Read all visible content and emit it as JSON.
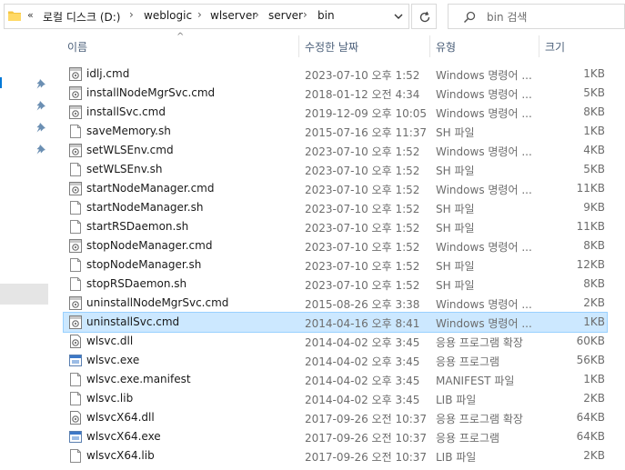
{
  "address": {
    "overflow": "«",
    "crumbs": [
      "로컬 디스크 (D:)",
      "weblogic",
      "wlserver",
      "server",
      "bin"
    ],
    "separator": "›"
  },
  "search": {
    "placeholder": "bin 검색"
  },
  "columns": {
    "name": "이름",
    "date": "수정한 날짜",
    "type": "유형",
    "size": "크기"
  },
  "files": [
    {
      "name": "idlj.cmd",
      "date": "2023-07-10 오후 1:52",
      "type": "Windows 명령어 ...",
      "size": "1KB",
      "icon": "cmd-file-icon"
    },
    {
      "name": "installNodeMgrSvc.cmd",
      "date": "2018-01-12 오전 4:34",
      "type": "Windows 명령어 ...",
      "size": "5KB",
      "icon": "cmd-file-icon"
    },
    {
      "name": "installSvc.cmd",
      "date": "2019-12-09 오후 10:05",
      "type": "Windows 명령어 ...",
      "size": "8KB",
      "icon": "cmd-file-icon"
    },
    {
      "name": "saveMemory.sh",
      "date": "2015-07-16 오후 11:37",
      "type": "SH 파일",
      "size": "1KB",
      "icon": "blank-file-icon"
    },
    {
      "name": "setWLSEnv.cmd",
      "date": "2023-07-10 오후 1:52",
      "type": "Windows 명령어 ...",
      "size": "4KB",
      "icon": "cmd-file-icon"
    },
    {
      "name": "setWLSEnv.sh",
      "date": "2023-07-10 오후 1:52",
      "type": "SH 파일",
      "size": "5KB",
      "icon": "blank-file-icon"
    },
    {
      "name": "startNodeManager.cmd",
      "date": "2023-07-10 오후 1:52",
      "type": "Windows 명령어 ...",
      "size": "11KB",
      "icon": "cmd-file-icon"
    },
    {
      "name": "startNodeManager.sh",
      "date": "2023-07-10 오후 1:52",
      "type": "SH 파일",
      "size": "9KB",
      "icon": "blank-file-icon"
    },
    {
      "name": "startRSDaemon.sh",
      "date": "2023-07-10 오후 1:52",
      "type": "SH 파일",
      "size": "11KB",
      "icon": "blank-file-icon"
    },
    {
      "name": "stopNodeManager.cmd",
      "date": "2023-07-10 오후 1:52",
      "type": "Windows 명령어 ...",
      "size": "8KB",
      "icon": "cmd-file-icon"
    },
    {
      "name": "stopNodeManager.sh",
      "date": "2023-07-10 오후 1:52",
      "type": "SH 파일",
      "size": "12KB",
      "icon": "blank-file-icon"
    },
    {
      "name": "stopRSDaemon.sh",
      "date": "2023-07-10 오후 1:52",
      "type": "SH 파일",
      "size": "8KB",
      "icon": "blank-file-icon"
    },
    {
      "name": "uninstallNodeMgrSvc.cmd",
      "date": "2015-08-26 오후 3:38",
      "type": "Windows 명령어 ...",
      "size": "2KB",
      "icon": "cmd-file-icon"
    },
    {
      "name": "uninstallSvc.cmd",
      "date": "2014-04-16 오후 8:41",
      "type": "Windows 명령어 ...",
      "size": "1KB",
      "icon": "cmd-file-icon",
      "selected": true
    },
    {
      "name": "wlsvc.dll",
      "date": "2014-04-02 오후 3:45",
      "type": "응용 프로그램 확장",
      "size": "60KB",
      "icon": "dll-file-icon"
    },
    {
      "name": "wlsvc.exe",
      "date": "2014-04-02 오후 3:45",
      "type": "응용 프로그램",
      "size": "56KB",
      "icon": "exe-file-icon"
    },
    {
      "name": "wlsvc.exe.manifest",
      "date": "2014-04-02 오후 3:45",
      "type": "MANIFEST 파일",
      "size": "1KB",
      "icon": "blank-file-icon"
    },
    {
      "name": "wlsvc.lib",
      "date": "2014-04-02 오후 3:45",
      "type": "LIB 파일",
      "size": "2KB",
      "icon": "blank-file-icon"
    },
    {
      "name": "wlsvcX64.dll",
      "date": "2017-09-26 오전 10:37",
      "type": "응용 프로그램 확장",
      "size": "64KB",
      "icon": "dll-file-icon"
    },
    {
      "name": "wlsvcX64.exe",
      "date": "2017-09-26 오전 10:37",
      "type": "응용 프로그램",
      "size": "64KB",
      "icon": "exe-file-icon"
    },
    {
      "name": "wlsvcX64.lib",
      "date": "2017-09-26 오전 10:37",
      "type": "LIB 파일",
      "size": "2KB",
      "icon": "blank-file-icon"
    }
  ],
  "colors": {
    "selection": "#cce8ff",
    "selection_border": "#99d1ff",
    "header_text": "#4c607a",
    "accent": "#0078d7"
  }
}
